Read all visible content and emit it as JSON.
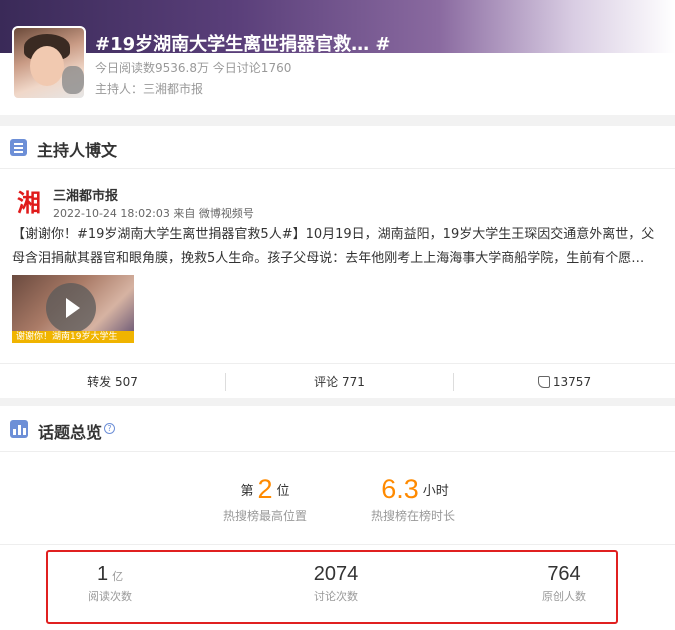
{
  "header": {
    "title": "#19岁湖南大学生离世捐器官救… #",
    "stats": "今日阅读数9536.8万 今日讨论1760",
    "host": "主持人：三湘都市报"
  },
  "host_post": {
    "section_title": "主持人博文",
    "logo_text": "湘",
    "author": "三湘都市报",
    "time": "2022-10-24 18:02:03 来自 微博视频号",
    "text": "【谢谢你！#19岁湖南大学生离世捐器官救5人#】10月19日，湖南益阳，19岁大学生王琛因交通意外离世，父母含泪捐献其器官和眼角膜，挽救5人生命。孩子父母说：去年他刚考上上海海事大学商船学院，生前有个愿…",
    "video_caption": "谢谢你！湖南19岁大学生",
    "repost": "转发 507",
    "comment": "评论 771",
    "like": "13757"
  },
  "overview": {
    "section_title": "话题总览",
    "help_icon": "?",
    "rank_prefix": "第",
    "rank_value": "2",
    "rank_suffix": "位",
    "rank_label": "热搜榜最高位置",
    "duration_value": "6.3",
    "duration_unit": "小时",
    "duration_label": "热搜榜在榜时长",
    "stats": [
      {
        "value": "1",
        "unit": "亿",
        "label": "阅读次数"
      },
      {
        "value": "2074",
        "unit": "",
        "label": "讨论次数"
      },
      {
        "value": "764",
        "unit": "",
        "label": "原创人数"
      }
    ],
    "highlight_color": "#e02020",
    "accent_color": "#ff8a00"
  }
}
